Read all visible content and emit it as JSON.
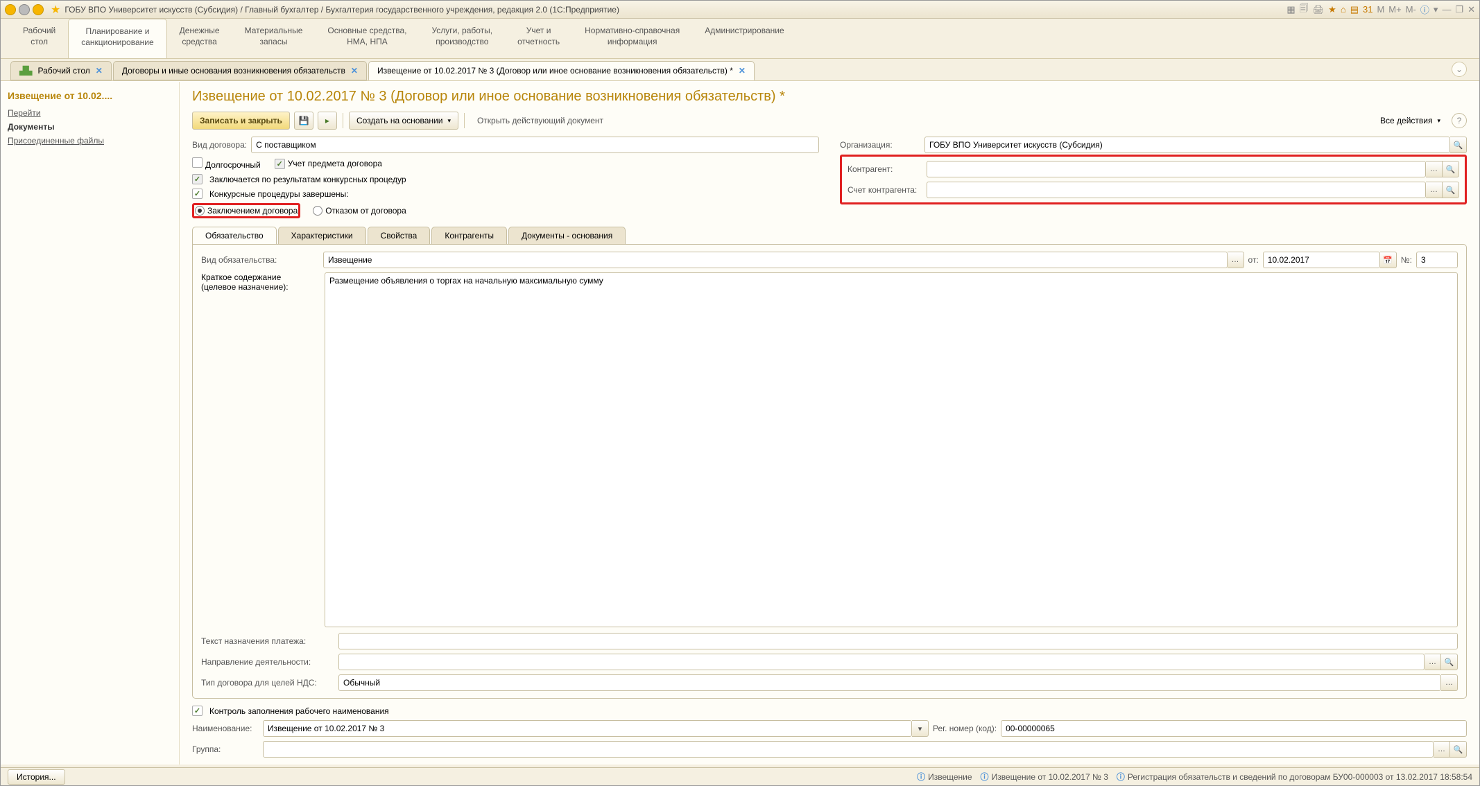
{
  "title": "ГОБУ ВПО Университет искусств (Субсидия) / Главный бухгалтер / Бухгалтерия государственного учреждения, редакция 2.0  (1С:Предприятие)",
  "mainmenu": [
    {
      "l1": "Рабочий",
      "l2": "стол"
    },
    {
      "l1": "Планирование и",
      "l2": "санкционирование"
    },
    {
      "l1": "Денежные",
      "l2": "средства"
    },
    {
      "l1": "Материальные",
      "l2": "запасы"
    },
    {
      "l1": "Основные средства,",
      "l2": "НМА, НПА"
    },
    {
      "l1": "Услуги, работы,",
      "l2": "производство"
    },
    {
      "l1": "Учет и",
      "l2": "отчетность"
    },
    {
      "l1": "Нормативно-справочная",
      "l2": "информация"
    },
    {
      "l1": "Администрирование",
      "l2": ""
    }
  ],
  "doctabs": {
    "desktop": "Рабочий стол",
    "t1": "Договоры и иные основания возникновения обязательств",
    "t2": "Извещение от 10.02.2017 № 3 (Договор или иное основание возникновения обязательств) *"
  },
  "sidebar": {
    "header": "Извещение от 10.02....",
    "links": [
      "Перейти",
      "Документы",
      "Присоединенные файлы"
    ]
  },
  "page": {
    "title": "Извещение от 10.02.2017 № 3 (Договор или иное основание возникновения обязательств) *",
    "save_close": "Записать и закрыть",
    "create_based": "Создать на основании",
    "open_doc": "Открыть действующий документ",
    "all_actions": "Все действия"
  },
  "fields": {
    "vid_dog_lbl": "Вид договора:",
    "vid_dog_val": "С поставщиком",
    "org_lbl": "Организация:",
    "org_val": "ГОБУ ВПО Университет искусств (Субсидия)",
    "kontr_lbl": "Контрагент:",
    "schet_lbl": "Счет контрагента:",
    "dolg": "Долгосрочный",
    "uchet": "Учет предмета договора",
    "konk_rez": "Заключается по результатам конкурсных процедур",
    "konk_done": "Конкурсные процедуры завершены:",
    "r1": "Заключением договора",
    "r2": "Отказом от договора"
  },
  "subtabs": [
    "Обязательство",
    "Характеристики",
    "Свойства",
    "Контрагенты",
    "Документы - основания"
  ],
  "ob": {
    "vid_lbl": "Вид обязательства:",
    "vid_val": "Извещение",
    "ot": "от:",
    "date": "10.02.2017",
    "num": "№:",
    "num_val": "3",
    "kr_lbl1": "Краткое содержание",
    "kr_lbl2": "(целевое назначение):",
    "kr_val": "Размещение объявления о торгах на начальную максимальную сумму",
    "text_lbl": "Текст назначения платежа:",
    "napr_lbl": "Направление деятельности:",
    "tip_lbl": "Тип договора для целей НДС:",
    "tip_val": "Обычный"
  },
  "below": {
    "kontrol": "Контроль заполнения рабочего наименования",
    "naim_lbl": "Наименование:",
    "naim_val": "Извещение от 10.02.2017 № 3",
    "reg_lbl": "Рег. номер (код):",
    "reg_val": "00-00000065",
    "grp_lbl": "Группа:"
  },
  "status": {
    "history": "История...",
    "s1": "Извещение",
    "s2": "Извещение от 10.02.2017 № 3",
    "s3": "Регистрация обязательств и сведений по договорам БУ00-000003 от 13.02.2017 18:58:54"
  }
}
